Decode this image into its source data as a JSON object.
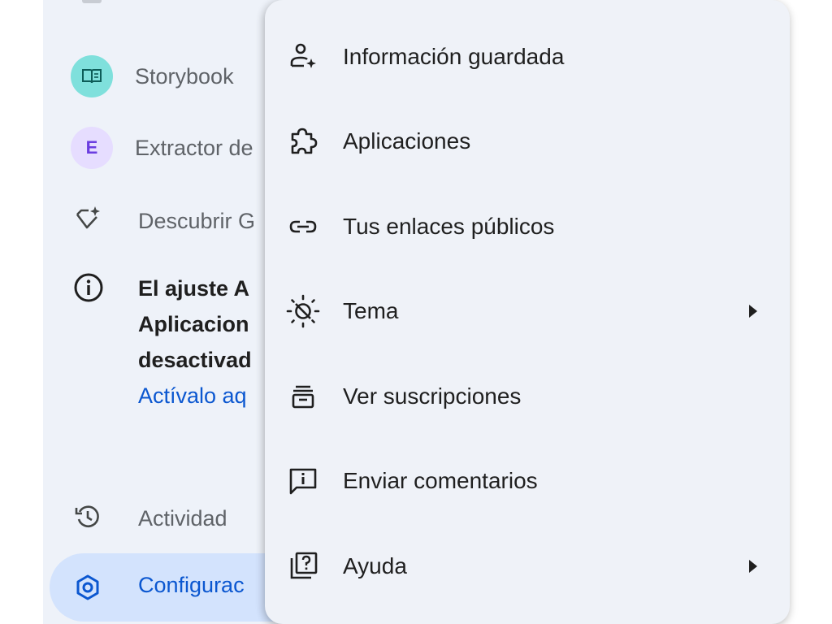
{
  "sidebar": {
    "items": [
      {
        "label": "Storybook",
        "icon": "book-icon"
      },
      {
        "label": "Extractor de",
        "avatar_letter": "E",
        "icon": "letter-avatar"
      },
      {
        "label": "Descubrir G",
        "icon": "gem-sparkle-icon"
      }
    ],
    "notice": {
      "lines": [
        "El ajuste A",
        "Aplicacion",
        "desactivad"
      ],
      "link": "Actívalo aq",
      "icon": "info-icon"
    },
    "activity": {
      "label": "Actividad",
      "icon": "history-icon"
    },
    "settings": {
      "label": "Configurac",
      "icon": "gear-icon"
    }
  },
  "menu": {
    "items": [
      {
        "label": "Información guardada",
        "icon": "person-sparkle-icon",
        "submenu": false
      },
      {
        "label": "Aplicaciones",
        "icon": "puzzle-icon",
        "submenu": false
      },
      {
        "label": "Tus enlaces públicos",
        "icon": "link-icon",
        "submenu": false
      },
      {
        "label": "Tema",
        "icon": "theme-icon",
        "submenu": true
      },
      {
        "label": "Ver suscripciones",
        "icon": "subscriptions-icon",
        "submenu": false
      },
      {
        "label": "Enviar comentarios",
        "icon": "feedback-icon",
        "submenu": false
      },
      {
        "label": "Ayuda",
        "icon": "help-icon",
        "submenu": true
      }
    ]
  },
  "colors": {
    "accent": "#0b57d0",
    "sidebar_bg": "#eef2f9",
    "menu_bg": "#eff2f8",
    "selected_bg": "#d3e3fd"
  }
}
